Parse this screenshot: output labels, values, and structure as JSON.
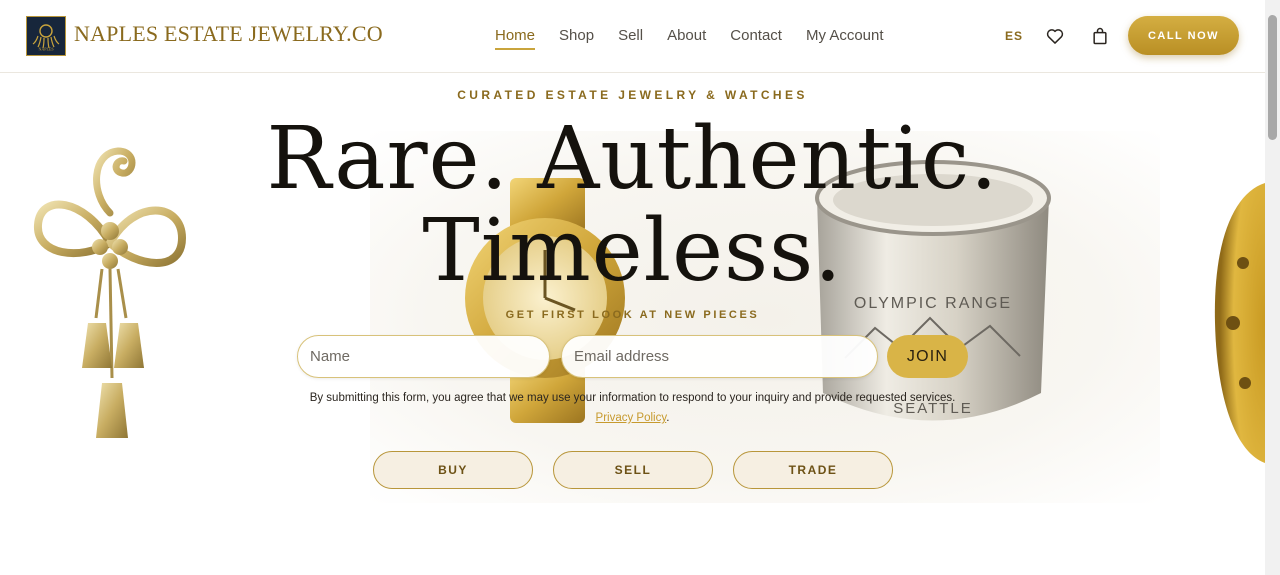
{
  "header": {
    "brand": "NAPLES ESTATE JEWELRY.CO",
    "logo_text": "NAPLES",
    "nav": [
      "Home",
      "Shop",
      "Sell",
      "About",
      "Contact",
      "My Account"
    ],
    "active_nav": "Home",
    "lang": "ES",
    "call_label": "CALL NOW"
  },
  "hero": {
    "eyebrow": "CURATED ESTATE JEWELRY & WATCHES",
    "headline_line1": "Rare. Authentic.",
    "headline_line2": "Timeless.",
    "sub_eyebrow": "GET FIRST LOOK AT NEW PIECES",
    "name_placeholder": "Name",
    "email_placeholder": "Email address",
    "join_label": "JOIN",
    "consent_text": "By submitting this form, you agree that we may use your information to respond to your inquiry and provide requested services.",
    "privacy_label": "Privacy Policy",
    "consent_end": ".",
    "buttons": [
      "BUY",
      "SELL",
      "TRADE"
    ],
    "ring_engraving_1": "OLYMPIC RANGE",
    "ring_engraving_2": "SEATTLE"
  },
  "colors": {
    "gold": "#c9a43c",
    "gold_dark": "#8a6a1e",
    "ink": "#15120d"
  }
}
